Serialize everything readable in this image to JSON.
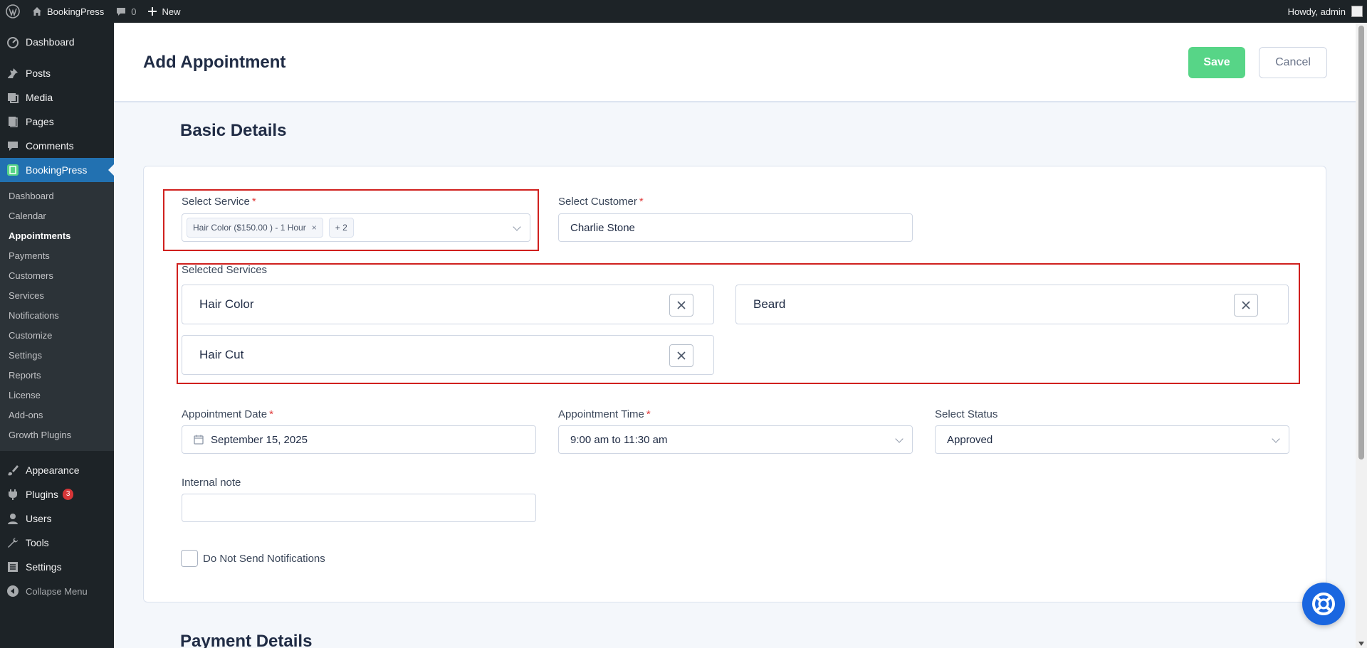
{
  "adminbar": {
    "site_name": "BookingPress",
    "comments_count": "0",
    "new_label": "New",
    "howdy": "Howdy, admin"
  },
  "sidebar": {
    "top_items": [
      {
        "label": "Dashboard",
        "icon": "dashboard-icon"
      },
      {
        "label": "Posts",
        "icon": "pin-icon"
      },
      {
        "label": "Media",
        "icon": "media-icon"
      },
      {
        "label": "Pages",
        "icon": "pages-icon"
      },
      {
        "label": "Comments",
        "icon": "comment-icon"
      },
      {
        "label": "BookingPress",
        "icon": "bookingpress-icon"
      }
    ],
    "submenu": [
      "Dashboard",
      "Calendar",
      "Appointments",
      "Payments",
      "Customers",
      "Services",
      "Notifications",
      "Customize",
      "Settings",
      "Reports",
      "License",
      "Add-ons",
      "Growth Plugins"
    ],
    "bottom_items": [
      {
        "label": "Appearance",
        "icon": "brush-icon"
      },
      {
        "label": "Plugins",
        "icon": "plugin-icon",
        "badge": "3"
      },
      {
        "label": "Users",
        "icon": "user-icon"
      },
      {
        "label": "Tools",
        "icon": "wrench-icon"
      },
      {
        "label": "Settings",
        "icon": "settings-icon"
      },
      {
        "label": "Collapse Menu",
        "icon": "collapse-icon"
      }
    ]
  },
  "header": {
    "title": "Add Appointment",
    "save_label": "Save",
    "cancel_label": "Cancel"
  },
  "basic": {
    "section_title": "Basic Details",
    "select_service_label": "Select Service",
    "service_tag": "Hair Color ($150.00 ) - 1 Hour",
    "service_tag_more": "+ 2",
    "select_customer_label": "Select Customer",
    "customer_value": "Charlie Stone",
    "selected_services_label": "Selected Services",
    "selected_services": [
      "Hair Color",
      "Beard",
      "Hair Cut"
    ],
    "date_label": "Appointment Date",
    "date_value": "September 15, 2025",
    "time_label": "Appointment Time",
    "time_value": "9:00 am to 11:30 am",
    "status_label": "Select Status",
    "status_value": "Approved",
    "note_label": "Internal note",
    "note_value": "",
    "notify_label": "Do Not Send Notifications",
    "required_mark": "*"
  },
  "payment": {
    "section_title": "Payment Details"
  },
  "colors": {
    "accent": "#2271b1",
    "save": "#57d587",
    "highlight": "#d0201e",
    "fab": "#1a66e0"
  }
}
